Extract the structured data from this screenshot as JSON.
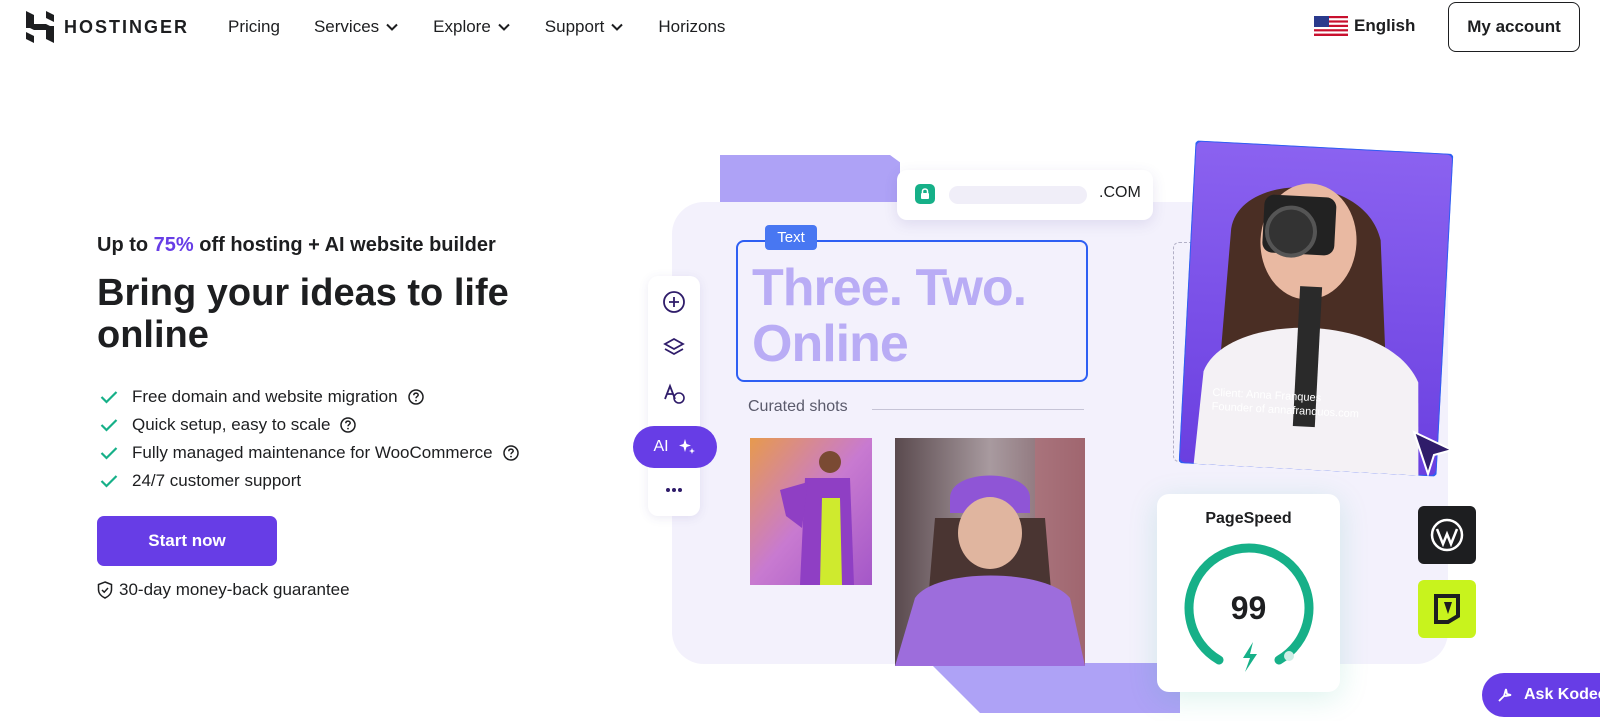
{
  "header": {
    "logo_text": "HOSTINGER",
    "nav": [
      {
        "label": "Pricing",
        "has_dropdown": false
      },
      {
        "label": "Services",
        "has_dropdown": true
      },
      {
        "label": "Explore",
        "has_dropdown": true
      },
      {
        "label": "Support",
        "has_dropdown": true
      },
      {
        "label": "Horizons",
        "has_dropdown": false
      }
    ],
    "language": "English",
    "account_button": "My account"
  },
  "hero": {
    "kicker_prefix": "Up to ",
    "kicker_highlight": "75%",
    "kicker_suffix": " off hosting + AI website builder",
    "title": "Bring your ideas to life online",
    "features": [
      {
        "text": "Free domain and website migration",
        "help": true
      },
      {
        "text": "Quick setup, easy to scale",
        "help": true
      },
      {
        "text": "Fully managed maintenance for WooCommerce",
        "help": true
      },
      {
        "text": "24/7 customer support",
        "help": false
      }
    ],
    "cta": "Start now",
    "guarantee": "30-day money-back guarantee"
  },
  "illustration": {
    "url_suffix": ".COM",
    "text_tag": "Text",
    "headline_line1": "Three. Two.",
    "headline_line2": "Online",
    "ai_button": "AI",
    "curated_label": "Curated shots",
    "client_name": "Client: Anna Franques",
    "client_role": "Founder of annafranquos.com",
    "pagespeed_label": "PageSpeed",
    "pagespeed_score": "99"
  },
  "chat": {
    "ask_button": "Ask Kodee"
  },
  "colors": {
    "brand_purple": "#673de6",
    "light_purple": "#aea2f6",
    "canvas_bg": "#f3f1fc",
    "success_green": "#16b088",
    "lime": "#c8f31d"
  }
}
